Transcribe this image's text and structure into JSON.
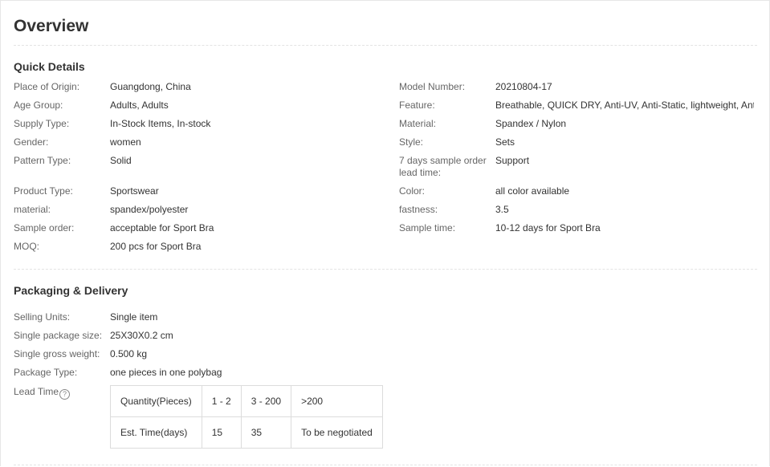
{
  "overview": {
    "title": "Overview"
  },
  "quick_details": {
    "title": "Quick Details",
    "left": [
      {
        "label": "Place of Origin:",
        "value": "Guangdong, China"
      },
      {
        "label": "Age Group:",
        "value": "Adults, Adults"
      },
      {
        "label": "Supply Type:",
        "value": "In-Stock Items, In-stock"
      },
      {
        "label": "Gender:",
        "value": "women"
      },
      {
        "label": "Pattern Type:",
        "value": "Solid"
      },
      {
        "label": "Product Type:",
        "value": "Sportswear"
      },
      {
        "label": "material:",
        "value": "spandex/polyester"
      },
      {
        "label": "Sample order:",
        "value": "acceptable for Sport Bra"
      },
      {
        "label": "MOQ:",
        "value": "200 pcs for Sport Bra"
      }
    ],
    "right": [
      {
        "label": "Model Number:",
        "value": "20210804-17"
      },
      {
        "label": "Feature:",
        "value": "Breathable, QUICK DRY, Anti-UV, Anti-Static, lightweight, Anti-..."
      },
      {
        "label": "Material:",
        "value": "Spandex / Nylon"
      },
      {
        "label": "Style:",
        "value": "Sets"
      },
      {
        "label": "7 days sample order",
        "label2": "lead time:",
        "value": "Support"
      },
      {
        "label": "Color:",
        "value": "all color available"
      },
      {
        "label": "fastness:",
        "value": "3.5"
      },
      {
        "label": "Sample time:",
        "value": "10-12 days for Sport Bra"
      }
    ]
  },
  "packaging": {
    "title": "Packaging & Delivery",
    "rows": [
      {
        "label": "Selling Units:",
        "value": "Single item"
      },
      {
        "label": "Single package size:",
        "value": "25X30X0.2 cm"
      },
      {
        "label": "Single gross weight:",
        "value": "0.500 kg"
      },
      {
        "label": "Package Type:",
        "value": "one pieces in one polybag"
      }
    ],
    "lead_time": {
      "label": "Lead Time",
      "help_icon": "?",
      "header": [
        "Quantity(Pieces)",
        "1 - 2",
        "3 - 200",
        ">200"
      ],
      "times": [
        "Est. Time(days)",
        "15",
        "35",
        "To be negotiated"
      ]
    }
  }
}
